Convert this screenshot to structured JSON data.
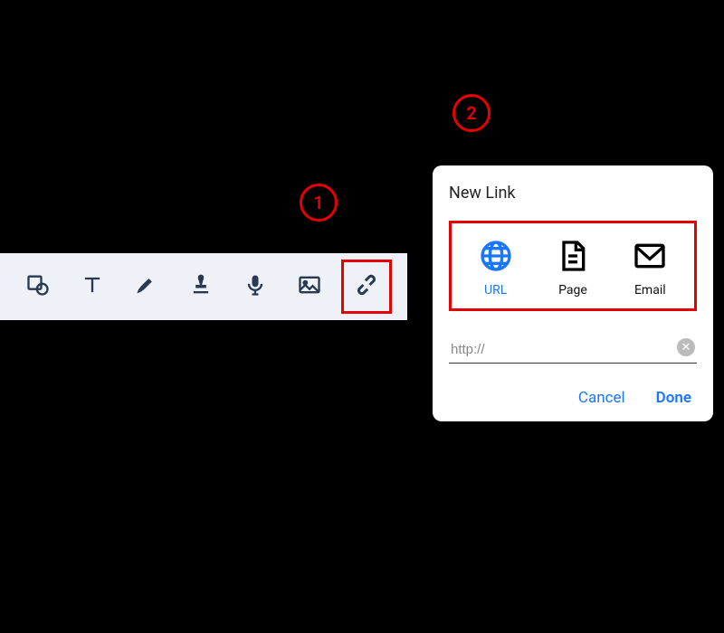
{
  "steps": {
    "one": "1",
    "two": "2"
  },
  "toolbar": {
    "icons": [
      "shape",
      "text",
      "pen",
      "stamp",
      "mic",
      "image",
      "link"
    ]
  },
  "dialog": {
    "title": "New Link",
    "types": {
      "url": "URL",
      "page": "Page",
      "email": "Email"
    },
    "input_value": "http://",
    "actions": {
      "cancel": "Cancel",
      "done": "Done"
    }
  }
}
